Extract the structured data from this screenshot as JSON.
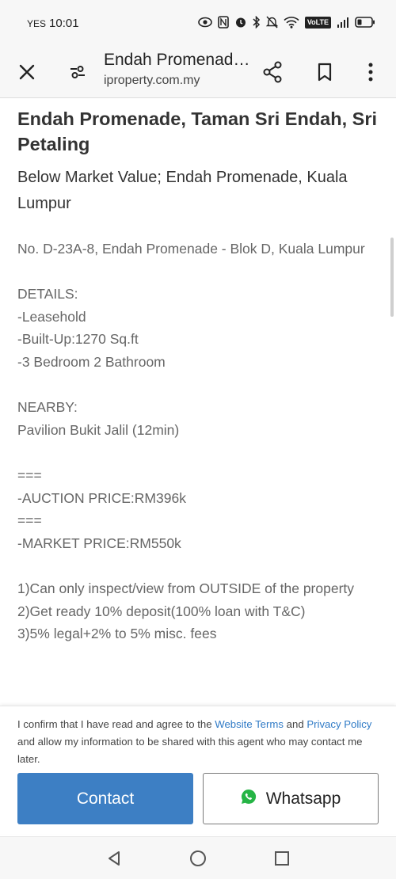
{
  "status_bar": {
    "carrier": "YES",
    "time": "10:01",
    "network_badge": "VoLTE",
    "icons": [
      "eye-icon",
      "nfc-icon",
      "alarm-icon",
      "bluetooth-icon",
      "mute-icon",
      "wifi-icon",
      "volte-icon",
      "signal-icon",
      "battery-icon"
    ]
  },
  "toolbar": {
    "page_title": "Endah Promenade, Taman Sri Endah, Sri Petaling",
    "domain": "iproperty.com.my",
    "icons": [
      "close-icon",
      "page-settings-icon",
      "share-icon",
      "bookmark-icon",
      "more-icon"
    ]
  },
  "listing": {
    "headline": "Endah Promenade, Taman Sri Endah, Sri Petaling",
    "subheadline": "Below Market Value; Endah Promenade, Kuala Lumpur",
    "description_lines": [
      "No. D-23A-8, Endah Promenade - Blok D, Kuala Lumpur",
      "",
      "DETAILS:",
      "-Leasehold",
      "-Built-Up:1270 Sq.ft",
      "-3 Bedroom 2 Bathroom",
      "",
      "NEARBY:",
      "Pavilion Bukit Jalil (12min)",
      "",
      "===",
      "-AUCTION PRICE:RM396k",
      "===",
      "-MARKET PRICE:RM550k",
      "",
      "1)Can only inspect/view from OUTSIDE of the property",
      "2)Get ready 10% deposit(100% loan with T&C)",
      "3)5% legal+2% to 5% misc. fees"
    ]
  },
  "agent_bar": {
    "consent_prefix": "I confirm that I have read and agree to the ",
    "terms_link": "Website Terms",
    "consent_and": " and ",
    "privacy_link": "Privacy Policy",
    "consent_suffix": " and allow my information to be shared with this agent who may contact me later.",
    "contact_label": "Contact",
    "whatsapp_label": "Whatsapp",
    "contact_color": "#3d7fc4",
    "whatsapp_color": "#25b445"
  },
  "nav_bar": {
    "icons": [
      "back-icon",
      "home-icon",
      "recents-icon"
    ]
  }
}
